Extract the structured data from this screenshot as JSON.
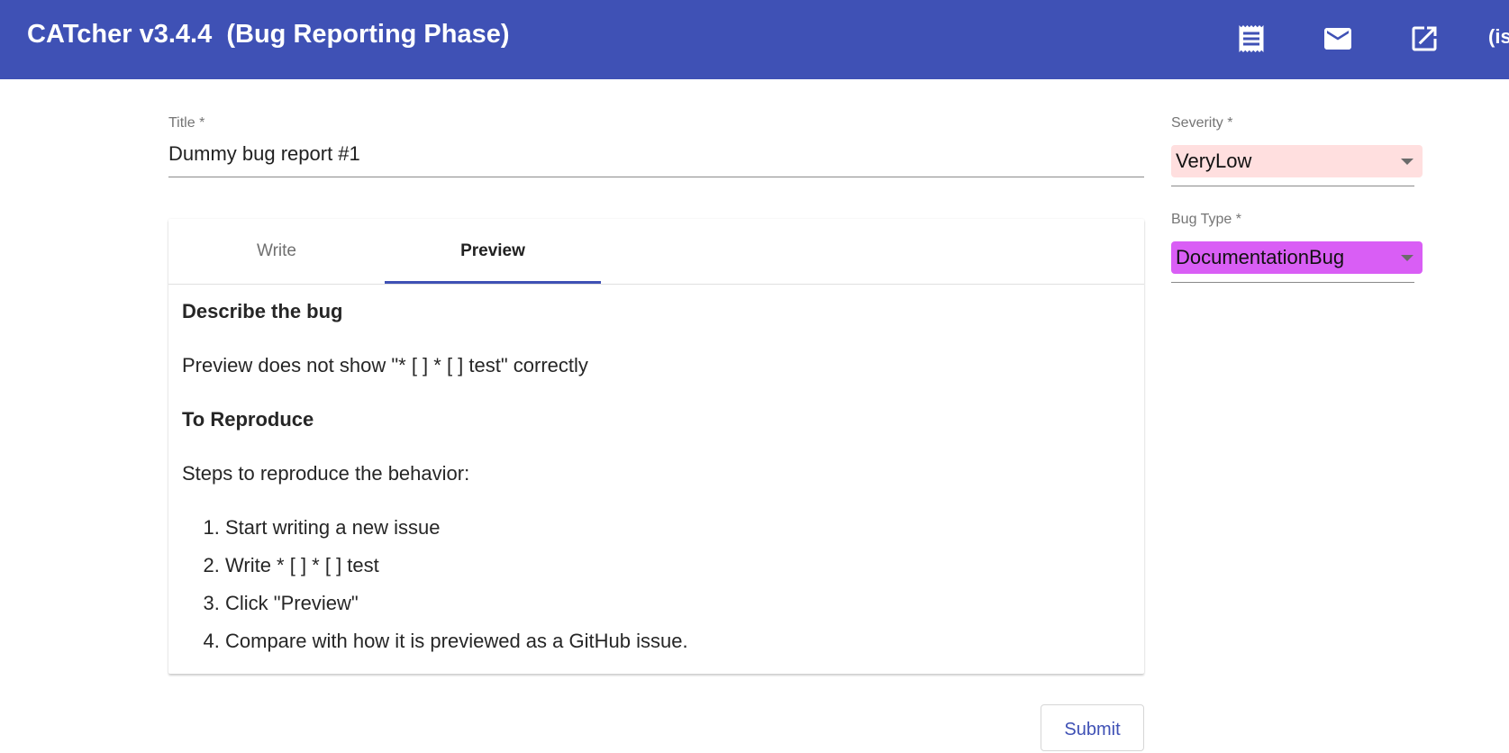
{
  "toolbar": {
    "title": "CATcher v3.4.4  (Bug Reporting Phase)",
    "background_color": "#3f51b5",
    "icons": [
      "receipt-icon",
      "mail-icon",
      "open-in-new-icon"
    ],
    "cut_text": "(is"
  },
  "form": {
    "title_label": "Title *",
    "title_value": "Dummy bug report #1",
    "tabs": [
      {
        "label": "Write",
        "active": false
      },
      {
        "label": "Preview",
        "active": true
      }
    ],
    "preview": {
      "heading1": "Describe the bug",
      "para1": "Preview does not show \"* [ ] * [ ] test\" correctly",
      "heading2": "To Reproduce",
      "para2": "Steps to reproduce the behavior:",
      "steps": [
        "Start writing a new issue",
        "Write * [ ] * [ ] test",
        "Click \"Preview\"",
        "Compare with how it is previewed as a GitHub issue."
      ]
    },
    "submit_label": "Submit"
  },
  "severity": {
    "label": "Severity *",
    "value": "VeryLow",
    "color": "#ffdfdf"
  },
  "bug_type": {
    "label": "Bug Type *",
    "value": "DocumentationBug",
    "color": "#d95ef5"
  }
}
